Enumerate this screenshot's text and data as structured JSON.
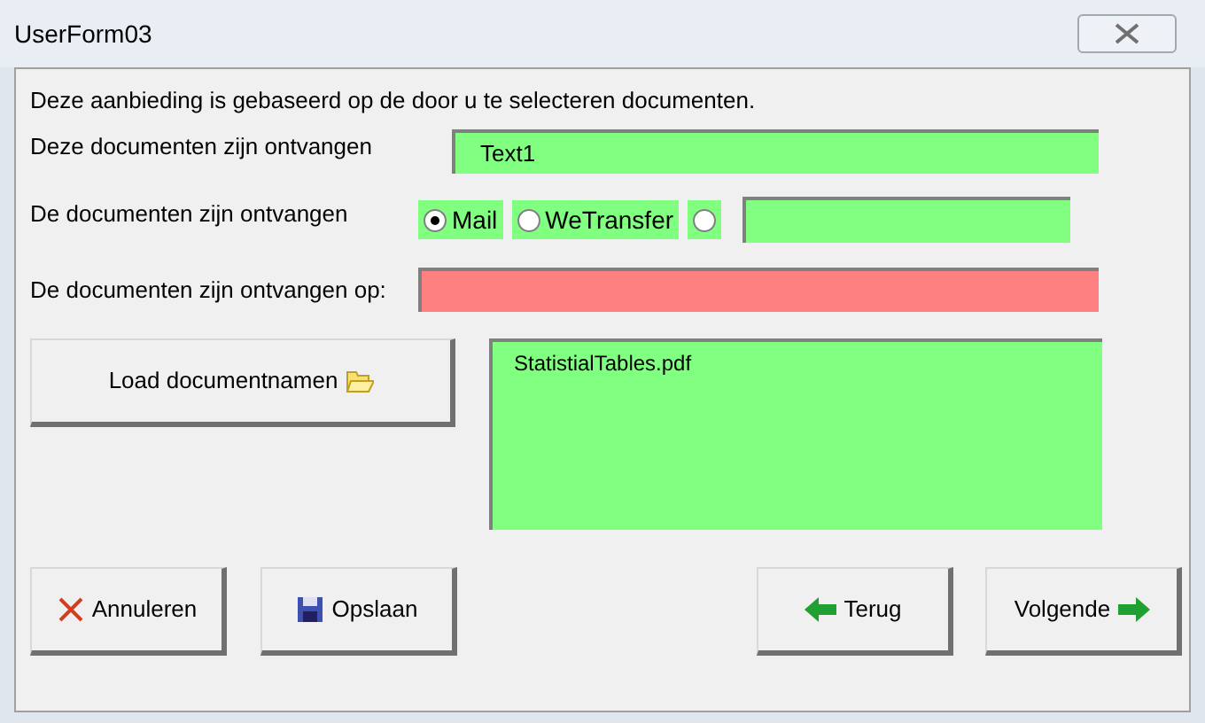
{
  "window": {
    "title": "UserForm03"
  },
  "intro": "Deze aanbieding is gebaseerd op de door u te selecteren documenten.",
  "received": {
    "label": "Deze documenten zijn ontvangen",
    "value": "Text1",
    "color": "#80ff80"
  },
  "via": {
    "label": "De documenten zijn ontvangen",
    "options": [
      {
        "label": "Mail",
        "selected": true
      },
      {
        "label": "WeTransfer",
        "selected": false
      },
      {
        "selected": false
      }
    ],
    "other": {
      "color": "#80ff80"
    }
  },
  "date": {
    "label": "De documenten zijn ontvangen op:",
    "color": "#ff8080"
  },
  "load_button": {
    "label": "Load documentnamen",
    "kind": "load"
  },
  "files": {
    "items": [
      "StatistialTables.pdf"
    ],
    "color": "#80ff80"
  },
  "buttons": [
    {
      "label": "Annuleren",
      "kind": "cancel"
    },
    {
      "label": "Opslaan",
      "kind": "save"
    },
    {
      "label": "Terug",
      "kind": "back"
    },
    {
      "label": "Volgende",
      "kind": "next"
    }
  ]
}
